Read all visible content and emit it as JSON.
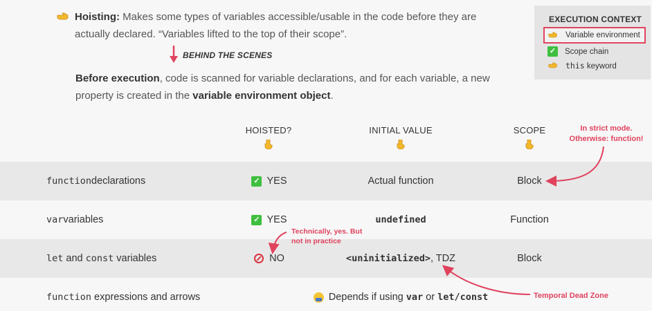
{
  "intro": {
    "hoisting_label": "Hoisting:",
    "hoisting_text_1": "Makes some types of variables accessible/usable in the code before they are",
    "hoisting_text_2": "actually declared. “Variables lifted to the top of their scope”.",
    "behind_label": "BEHIND THE SCENES",
    "before_bold_1": "Before execution",
    "before_text_1": ", code is scanned for variable declarations, and for each variable, a new",
    "before_text_2": "property is created in the ",
    "before_bold_2": "variable environment object",
    "before_text_3": "."
  },
  "context_box": {
    "title": "EXECUTION CONTEXT",
    "items": [
      {
        "icon": "pointing-hand-icon",
        "label": "Variable environment",
        "selected": true
      },
      {
        "icon": "check-icon",
        "label": "Scope chain",
        "selected": false
      },
      {
        "icon": "pointing-hand-icon",
        "label_code": "this",
        "label": " keyword",
        "selected": false
      }
    ]
  },
  "table": {
    "headers": [
      "HOISTED?",
      "INITIAL VALUE",
      "SCOPE"
    ],
    "rows": [
      {
        "kind_code": "function",
        "kind_text": " declarations",
        "hoisted": "YES",
        "initial": "Actual function",
        "scope": "Block"
      },
      {
        "kind_code": "var",
        "kind_text": " variables",
        "hoisted": "YES",
        "initial_code": "undefined",
        "scope": "Function"
      },
      {
        "kind_code_1": "let",
        "kind_mid": " and ",
        "kind_code_2": "const",
        "kind_text": " variables",
        "hoisted": "NO",
        "initial_code": "<uninitialized>",
        "initial_tail": ", TDZ",
        "scope": "Block"
      },
      {
        "kind_code": "function",
        "kind_text": " expressions and arrows",
        "depends_text": "Depends if using ",
        "depends_code_1": "var",
        "depends_or": " or ",
        "depends_code_2": "let/const"
      }
    ]
  },
  "annotations": {
    "strict_1": "In strict mode.",
    "strict_2": "Otherwise: function!",
    "tech_1": "Technically, yes. But",
    "tech_2": "not in practice",
    "tdz": "Temporal Dead Zone"
  },
  "colors": {
    "accent": "#e0435e",
    "check": "#3fbf3f",
    "stripe": "#e8e8e8"
  }
}
